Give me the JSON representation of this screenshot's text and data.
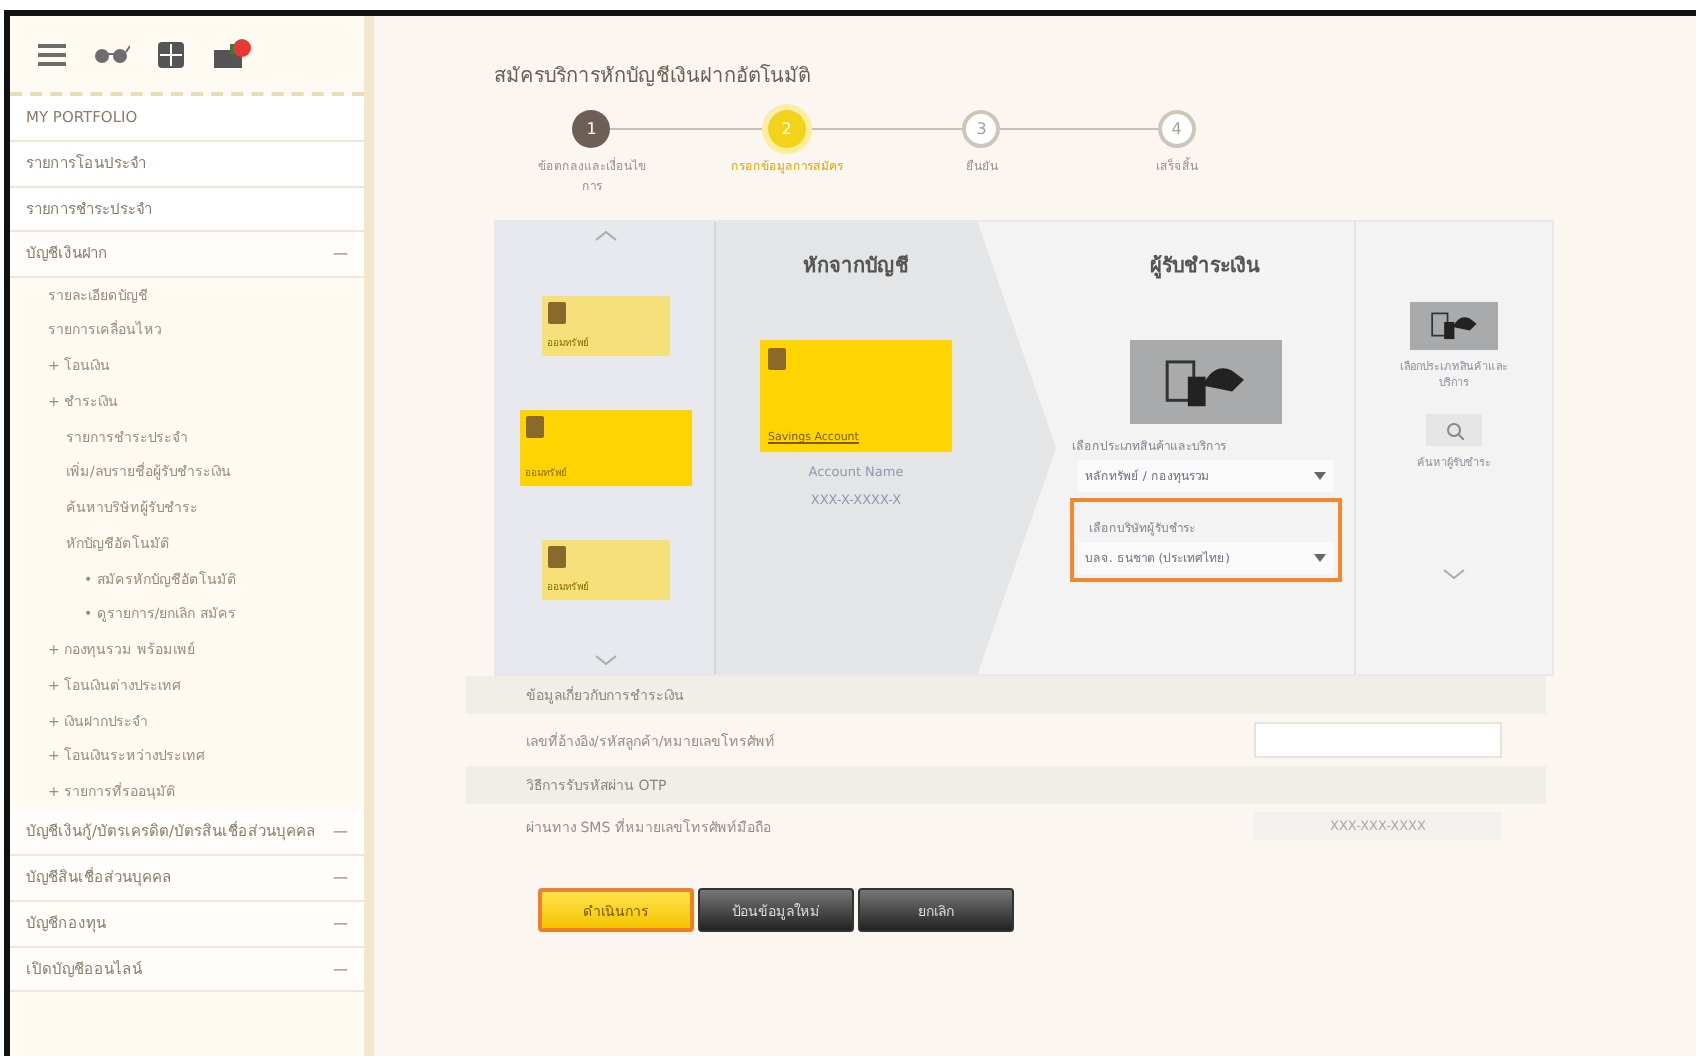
{
  "sidebar": {
    "items": [
      {
        "label": "MY PORTFOLIO",
        "kind": "link"
      },
      {
        "label": "รายการโอนประจำ",
        "kind": "link"
      },
      {
        "label": "รายการชำระประจำ",
        "kind": "link"
      },
      {
        "label": "บัญชีเงินฝาก",
        "kind": "section",
        "toggle": "—",
        "children": [
          {
            "label": "รายละเอียดบัญชี"
          },
          {
            "label": "รายการเคลื่อนไหว"
          },
          {
            "label": "โอนเงิน",
            "marker": "+"
          },
          {
            "label": "ชำระเงิน",
            "marker": "+",
            "children": [
              {
                "label": "รายการชำระประจำ"
              },
              {
                "label": "เพิ่ม/ลบรายชื่อผู้รับชำระเงิน"
              },
              {
                "label": "ค้นหาบริษัทผู้รับชำระ"
              },
              {
                "label": "หักบัญชีอัตโนมัติ",
                "children": [
                  {
                    "label": "สมัครหักบัญชีอัตโนมัติ",
                    "marker": "•"
                  },
                  {
                    "label": "ดูรายการ/ยกเลิก สมัคร",
                    "marker": "•"
                  }
                ]
              }
            ]
          },
          {
            "label": "กองทุนรวม พร้อมเพย์",
            "marker": "+"
          },
          {
            "label": "โอนเงินต่างประเทศ",
            "marker": "+"
          },
          {
            "label": "เงินฝากประจำ",
            "marker": "+"
          },
          {
            "label": "โอนเงินระหว่างประเทศ",
            "marker": "+"
          },
          {
            "label": "รายการที่รออนุมัติ",
            "marker": "+"
          }
        ]
      },
      {
        "label": "บัญชีเงินกู้/บัตรเครดิต/บัตรสินเชื่อส่วนบุคคล",
        "kind": "section",
        "toggle": "—"
      },
      {
        "label": "บัญชีสินเชื่อส่วนบุคคล",
        "kind": "section",
        "toggle": "—"
      },
      {
        "label": "บัญชีกองทุน",
        "kind": "section",
        "toggle": "—"
      },
      {
        "label": "เปิดบัญชีออนไลน์",
        "kind": "section",
        "toggle": "—"
      }
    ]
  },
  "page": {
    "title": "สมัครบริการหักบัญชีเงินฝากอัตโนมัติ",
    "steps": [
      {
        "number": "1",
        "label": "ข้อตกลงและเงื่อนไขการ",
        "done": true,
        "current": false
      },
      {
        "number": "2",
        "label": "กรอกข้อมูลการสมัคร",
        "done": false,
        "current": true
      },
      {
        "number": "3",
        "label": "ยืนยัน",
        "done": false,
        "current": false
      },
      {
        "number": "4",
        "label": "เสร็จสิ้น",
        "done": false,
        "current": false
      }
    ],
    "cards": [
      {
        "label": "ออมทรัพย์",
        "selected": false
      },
      {
        "label": "ออมทรัพย์",
        "selected": true
      },
      {
        "label": "ออมทรัพย์",
        "selected": false
      }
    ],
    "account": {
      "heading": "หักจากบัญชี",
      "card_label": "Savings Account",
      "name": "Account Name",
      "number": "XXX-X-XXXX-X"
    },
    "payee": {
      "heading": "ผู้รับชำระเงิน",
      "type_label": "เลือกประเภทสินค้าและบริการ",
      "type_value": "หลักทรัพย์ / กองทุนรวม",
      "company_label": "เลือกบริษัทผู้รับชำระ",
      "company_value": "บลจ. ธนชาต (ประเทศไทย)",
      "company_highlighted": true
    },
    "side_options": [
      {
        "label": "เลือกประเภทสินค้าและบริการ",
        "kind": "category"
      },
      {
        "label": "ค้นหาผู้รับชำระ",
        "kind": "search"
      }
    ],
    "sections": [
      {
        "title": "ข้อมูลเกี่ยวกับการชำระเงิน",
        "row_label": "เลขที่อ้างอิง/รหัสลูกค้า/หมายเลขโทรศัพท์",
        "kind": "input"
      },
      {
        "title": "วิธีการรับรหัสผ่าน OTP",
        "row_label": "ผ่านทาง SMS ที่หมายเลขโทรศัพท์มือถือ",
        "value": "XXX-XXX-XXXX",
        "kind": "readonly"
      }
    ],
    "buttons": [
      {
        "label": "ดำเนินการ",
        "kind": "primary"
      },
      {
        "label": "ป้อนข้อมูลใหม่",
        "kind": "dark"
      },
      {
        "label": "ยกเลิก",
        "kind": "dark"
      }
    ]
  }
}
